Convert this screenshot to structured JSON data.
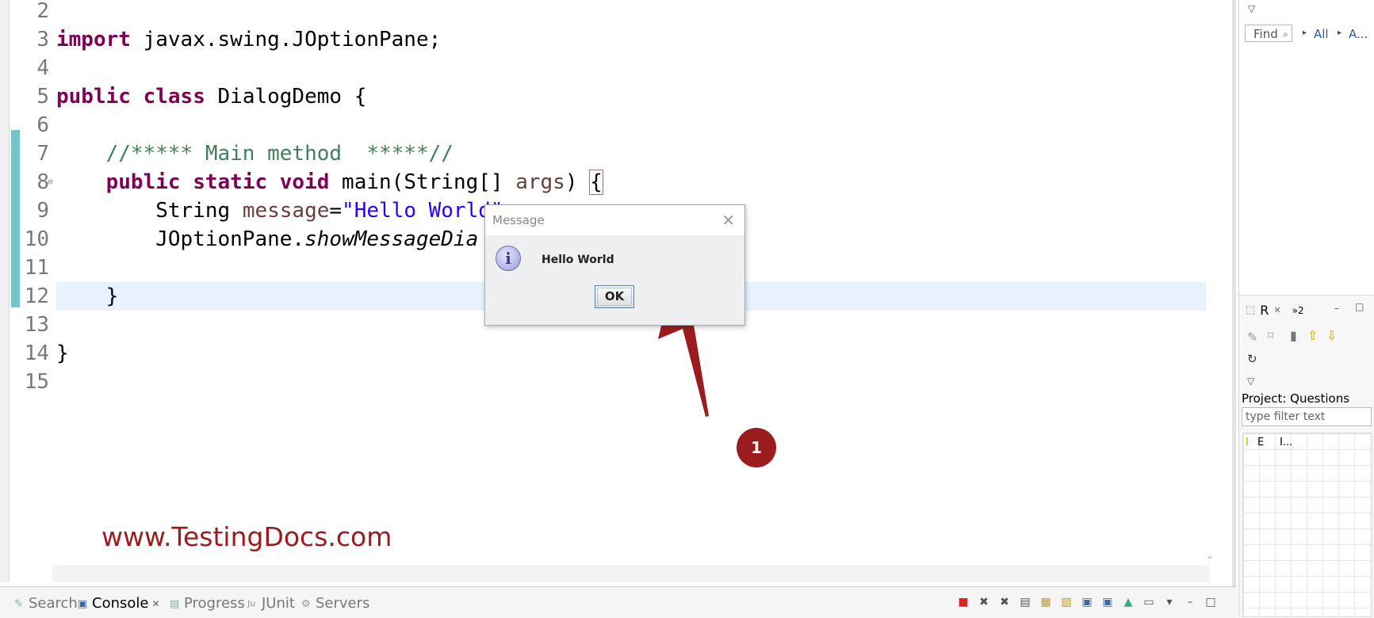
{
  "editor": {
    "lines": [
      {
        "num": "2",
        "segments": []
      },
      {
        "num": "3",
        "segments": [
          {
            "t": "import",
            "c": "kw"
          },
          {
            "t": " javax.swing.JOptionPane;",
            "c": ""
          }
        ]
      },
      {
        "num": "4",
        "segments": []
      },
      {
        "num": "5",
        "segments": [
          {
            "t": "public",
            "c": "kw"
          },
          {
            "t": " ",
            "c": ""
          },
          {
            "t": "class",
            "c": "kw"
          },
          {
            "t": " DialogDemo {",
            "c": ""
          }
        ]
      },
      {
        "num": "6",
        "segments": []
      },
      {
        "num": "7",
        "segments": [
          {
            "t": "    //***** Main method  *****//",
            "c": "cm"
          }
        ]
      },
      {
        "num": "8",
        "segments": [
          {
            "t": "    ",
            "c": ""
          },
          {
            "t": "public",
            "c": "kw"
          },
          {
            "t": " ",
            "c": ""
          },
          {
            "t": "static",
            "c": "kw"
          },
          {
            "t": " ",
            "c": ""
          },
          {
            "t": "void",
            "c": "kw"
          },
          {
            "t": " main(String[] ",
            "c": ""
          },
          {
            "t": "args",
            "c": "var"
          },
          {
            "t": ") ",
            "c": ""
          },
          {
            "t": "{",
            "c": "bracket-box"
          }
        ]
      },
      {
        "num": "9",
        "segments": [
          {
            "t": "        String ",
            "c": ""
          },
          {
            "t": "message",
            "c": "var"
          },
          {
            "t": "=",
            "c": ""
          },
          {
            "t": "\"Hello World\"",
            "c": "str"
          },
          {
            "t": ";",
            "c": ""
          }
        ]
      },
      {
        "num": "10",
        "segments": [
          {
            "t": "        JOptionPane.",
            "c": ""
          },
          {
            "t": "showMessageDia",
            "c": "it"
          }
        ]
      },
      {
        "num": "11",
        "segments": []
      },
      {
        "num": "12",
        "segments": [
          {
            "t": "    }",
            "c": ""
          }
        ]
      },
      {
        "num": "13",
        "segments": []
      },
      {
        "num": "14",
        "segments": [
          {
            "t": "}",
            "c": ""
          }
        ]
      },
      {
        "num": "15",
        "segments": []
      }
    ],
    "watermark": "www.TestingDocs.com"
  },
  "dialog": {
    "title": "Message",
    "close_glyph": "✕",
    "icon_glyph": "i",
    "message": "Hello World",
    "ok_label": "OK"
  },
  "annotation": {
    "badge": "1",
    "arrow_color": "#9b1c1f"
  },
  "bottom_tabs": [
    {
      "label": "Search",
      "icon": "✎",
      "active": false
    },
    {
      "label": "Console",
      "icon": "▣",
      "active": true,
      "close": "✕"
    },
    {
      "label": "Progress",
      "icon": "▤",
      "active": false
    },
    {
      "label": "JUnit",
      "icon": "Ju",
      "active": false
    },
    {
      "label": "Servers",
      "icon": "⚙",
      "active": false
    }
  ],
  "right_panel": {
    "find_placeholder": "Find",
    "link_all": "All",
    "link_a": "A...",
    "tab_label": "R",
    "tab_more": "»2",
    "project_label": "Project: Questions",
    "filter_placeholder": "type filter text",
    "col_1": "I",
    "col_2": "E",
    "col_3": "I..."
  }
}
